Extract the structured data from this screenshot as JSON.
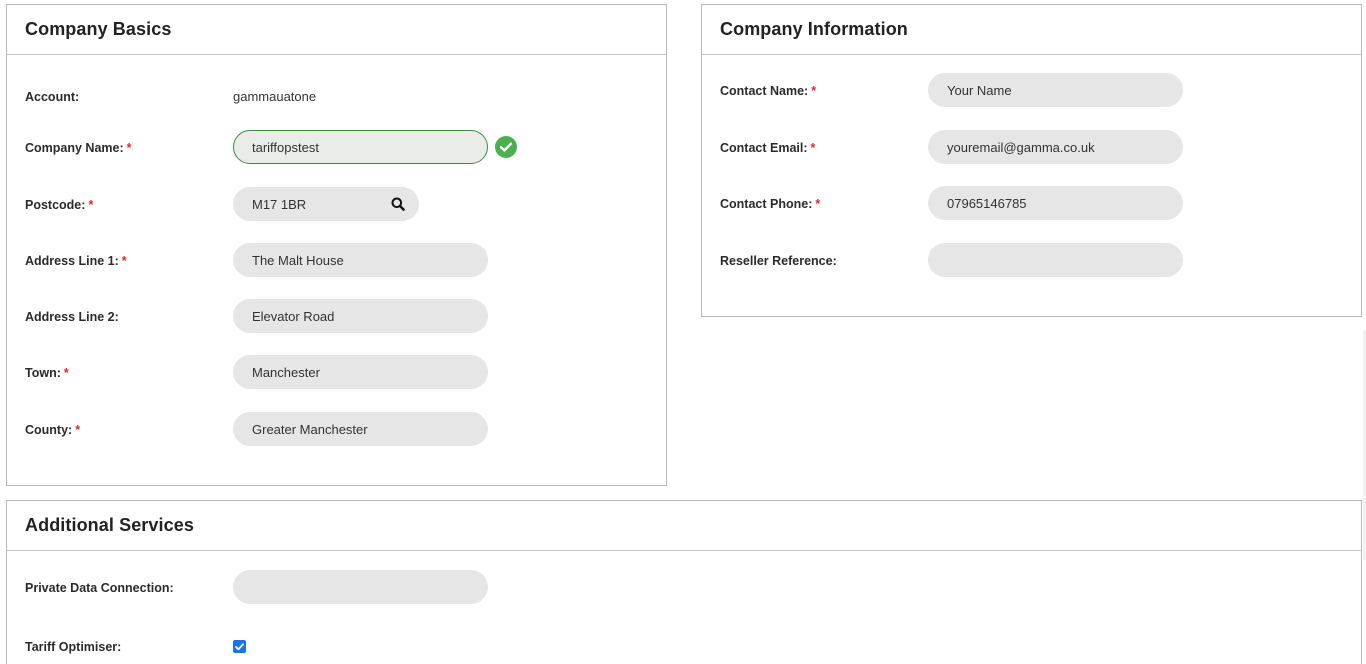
{
  "company_basics": {
    "title": "Company Basics",
    "account_label": "Account:",
    "account_value": "gammauatone",
    "company_name_label": "Company Name:",
    "company_name_value": "tariffopstest",
    "postcode_label": "Postcode:",
    "postcode_value": "M17 1BR",
    "address1_label": "Address Line 1:",
    "address1_value": "The Malt House",
    "address2_label": "Address Line 2:",
    "address2_value": "Elevator Road",
    "town_label": "Town:",
    "town_value": "Manchester",
    "county_label": "County:",
    "county_value": "Greater Manchester",
    "required_marker": "*"
  },
  "company_information": {
    "title": "Company Information",
    "contact_name_label": "Contact Name:",
    "contact_name_value": "Your Name",
    "contact_email_label": "Contact Email:",
    "contact_email_value": "youremail@gamma.co.uk",
    "contact_phone_label": "Contact Phone:",
    "contact_phone_value": "07965146785",
    "reseller_ref_label": "Reseller Reference:",
    "reseller_ref_value": ""
  },
  "additional_services": {
    "title": "Additional Services",
    "private_data_label": "Private Data Connection:",
    "private_data_value": "",
    "tariff_optimiser_label": "Tariff Optimiser:",
    "tariff_optimiser_checked": true
  },
  "colors": {
    "required": "#e0262c",
    "valid": "#4caf50",
    "checkbox": "#1a73e8",
    "field_bg": "#e6e6e6"
  },
  "icons": {
    "valid": "check-circle-icon",
    "search": "search-icon",
    "checkbox": "checkmark-icon"
  }
}
